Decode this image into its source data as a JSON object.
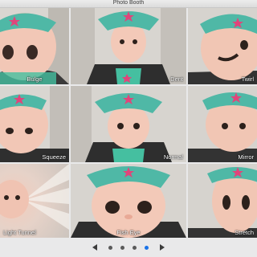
{
  "window": {
    "title": "Photo Booth"
  },
  "effects": [
    {
      "label": "Bulge"
    },
    {
      "label": "Dent"
    },
    {
      "label": "Twirl"
    },
    {
      "label": "Squeeze"
    },
    {
      "label": "Normal"
    },
    {
      "label": "Mirror"
    },
    {
      "label": "Light Tunnel"
    },
    {
      "label": "Fish Eye"
    },
    {
      "label": "Stretch"
    }
  ],
  "pager": {
    "pages": 4,
    "active_page": 4,
    "prev_icon": "chevron-left-icon",
    "next_icon": "chevron-right-icon"
  },
  "colors": {
    "active_dot": "#1a73e8",
    "crown": "#4fb8a6",
    "star": "#e0457b"
  }
}
